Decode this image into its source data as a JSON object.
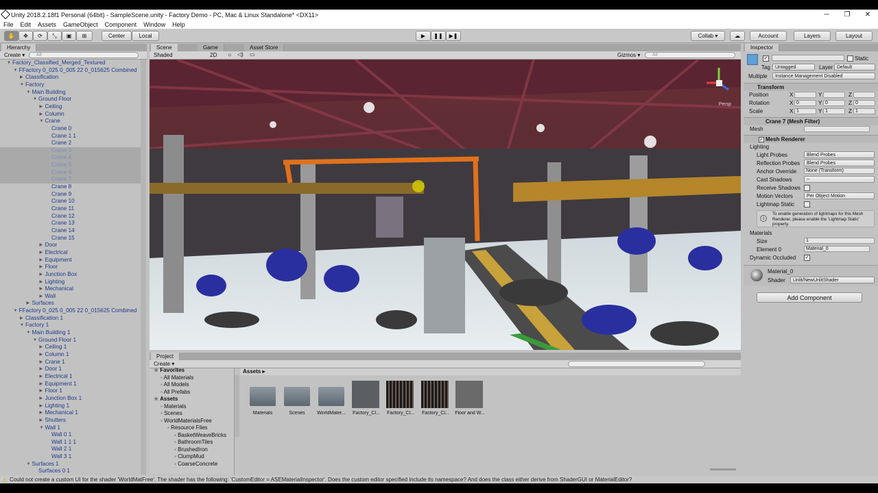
{
  "window": {
    "title": "Unity 2018.2.18f1 Personal (64bit) - SampleScene.unity - Factory Demo - PC, Mac & Linux Standalone* <DX11>"
  },
  "menu": [
    "File",
    "Edit",
    "Assets",
    "GameObject",
    "Component",
    "Window",
    "Help"
  ],
  "toolbar": {
    "pivot": "Center",
    "space": "Local",
    "collab": "Collab ▾",
    "account": "Account",
    "layers": "Layers",
    "layout": "Layout"
  },
  "hierarchy": {
    "tab": "Hierarchy",
    "create": "Create ▾",
    "search_placeholder": "All",
    "rows": [
      {
        "t": "Factory_Classified_Merged_Textured",
        "d": 0,
        "a": "open"
      },
      {
        "t": "FFactory 0_025 0_005 22 0_015625 Combined",
        "d": 1,
        "a": "open"
      },
      {
        "t": "Classification",
        "d": 2,
        "a": "closed"
      },
      {
        "t": "Factory",
        "d": 2,
        "a": "open"
      },
      {
        "t": "Main Building",
        "d": 3,
        "a": "open"
      },
      {
        "t": "Ground Floor",
        "d": 4,
        "a": "open"
      },
      {
        "t": "Ceiling",
        "d": 5,
        "a": "closed"
      },
      {
        "t": "Column",
        "d": 5,
        "a": "closed"
      },
      {
        "t": "Crane",
        "d": 5,
        "a": "open"
      },
      {
        "t": "Crane 0",
        "d": 6,
        "a": ""
      },
      {
        "t": "Crane 1 1",
        "d": 6,
        "a": ""
      },
      {
        "t": "Crane 2",
        "d": 6,
        "a": ""
      },
      {
        "t": "Crane 3",
        "d": 6,
        "a": "",
        "s": 1
      },
      {
        "t": "Crane 4",
        "d": 6,
        "a": "",
        "s": 1
      },
      {
        "t": "Crane 5",
        "d": 6,
        "a": "",
        "s": 1
      },
      {
        "t": "Crane 6",
        "d": 6,
        "a": "",
        "s": 1
      },
      {
        "t": "Crane 7",
        "d": 6,
        "a": "",
        "s": 1
      },
      {
        "t": "Crane 8",
        "d": 6,
        "a": ""
      },
      {
        "t": "Crane 9",
        "d": 6,
        "a": ""
      },
      {
        "t": "Crane 10",
        "d": 6,
        "a": ""
      },
      {
        "t": "Crane 11",
        "d": 6,
        "a": ""
      },
      {
        "t": "Crane 12",
        "d": 6,
        "a": ""
      },
      {
        "t": "Crane 13",
        "d": 6,
        "a": ""
      },
      {
        "t": "Crane 14",
        "d": 6,
        "a": ""
      },
      {
        "t": "Crane 15",
        "d": 6,
        "a": ""
      },
      {
        "t": "Door",
        "d": 5,
        "a": "closed"
      },
      {
        "t": "Electrical",
        "d": 5,
        "a": "closed"
      },
      {
        "t": "Equipment",
        "d": 5,
        "a": "closed"
      },
      {
        "t": "Floor",
        "d": 5,
        "a": "closed"
      },
      {
        "t": "Junction Box",
        "d": 5,
        "a": "closed"
      },
      {
        "t": "Lighting",
        "d": 5,
        "a": "closed"
      },
      {
        "t": "Mechanical",
        "d": 5,
        "a": "closed"
      },
      {
        "t": "Wall",
        "d": 5,
        "a": "closed"
      },
      {
        "t": "Surfaces",
        "d": 3,
        "a": "closed"
      },
      {
        "t": "FFactory 0_025 0_005 22 0_015625 Combined",
        "d": 1,
        "a": "open"
      },
      {
        "t": "Classification 1",
        "d": 2,
        "a": "closed"
      },
      {
        "t": "Factory 1",
        "d": 2,
        "a": "open"
      },
      {
        "t": "Main Building 1",
        "d": 3,
        "a": "open"
      },
      {
        "t": "Ground Floor 1",
        "d": 4,
        "a": "open"
      },
      {
        "t": "Ceiling 1",
        "d": 5,
        "a": "closed"
      },
      {
        "t": "Column 1",
        "d": 5,
        "a": "closed"
      },
      {
        "t": "Crane 1",
        "d": 5,
        "a": "closed"
      },
      {
        "t": "Door 1",
        "d": 5,
        "a": "closed"
      },
      {
        "t": "Electrical 1",
        "d": 5,
        "a": "closed"
      },
      {
        "t": "Equipment 1",
        "d": 5,
        "a": "closed"
      },
      {
        "t": "Floor 1",
        "d": 5,
        "a": "closed"
      },
      {
        "t": "Junction Box 1",
        "d": 5,
        "a": "closed"
      },
      {
        "t": "Lighting 1",
        "d": 5,
        "a": "closed"
      },
      {
        "t": "Mechanical 1",
        "d": 5,
        "a": "closed"
      },
      {
        "t": "Shutters",
        "d": 5,
        "a": "closed"
      },
      {
        "t": "Wall 1",
        "d": 5,
        "a": "open"
      },
      {
        "t": "Wall 0 1",
        "d": 6,
        "a": ""
      },
      {
        "t": "Wall 1 1 1",
        "d": 6,
        "a": ""
      },
      {
        "t": "Wall 2 1",
        "d": 6,
        "a": ""
      },
      {
        "t": "Wall 3 1",
        "d": 6,
        "a": ""
      },
      {
        "t": "Surfaces 1",
        "d": 3,
        "a": "open"
      },
      {
        "t": "Surfaces 0 1",
        "d": 4,
        "a": ""
      }
    ]
  },
  "scene": {
    "tabs": [
      "Scene",
      "Game",
      "Asset Store"
    ],
    "shading": "Shaded",
    "mode2d": "2D",
    "gizmos": "Gizmos ▾",
    "search_placeholder": "All",
    "persp": "Persp"
  },
  "inspector": {
    "tab": "Inspector",
    "static": "Static",
    "tag_label": "Tag",
    "tag": "Untagged",
    "layer_label": "Layer",
    "layer": "Default",
    "multiple": "Multiple",
    "instance_mgmt": "Instance Management Disabled",
    "transform": "Transform",
    "position": "Position",
    "rotation": "Rotation",
    "scale": "Scale",
    "px": "X",
    "py": "Y",
    "pz": "Z",
    "rot_x": "0",
    "rot_y": "0",
    "rot_z": "0",
    "scale_x": "1",
    "scale_y": "1",
    "scale_z": "1",
    "mesh_filter": "Crane 7 (Mesh Filter)",
    "mesh_label": "Mesh",
    "mesh_renderer": "Mesh Renderer",
    "lighting": "Lighting",
    "light_probes_label": "Light Probes",
    "light_probes": "Blend Probes",
    "refl_probes_label": "Reflection Probes",
    "refl_probes": "Blend Probes",
    "anchor_label": "Anchor Override",
    "anchor": "None (Transform)",
    "cast_label": "Cast Shadows",
    "cast": "--",
    "receive_label": "Receive Shadows",
    "motion_label": "Motion Vectors",
    "motion": "Per Object Motion",
    "lightmap_label": "Lightmap Static",
    "lightmap_note": "To enable generation of lightmaps for this Mesh Renderer, please enable the 'Lightmap Static' property.",
    "materials": "Materials",
    "size_label": "Size",
    "size": "1",
    "element0_label": "Element 0",
    "element0": "Material_0",
    "dynocc_label": "Dynamic Occluded",
    "material_name": "Material_0",
    "shader_label": "Shader",
    "shader": "Unlit/NewUnlitShader",
    "add_component": "Add Component"
  },
  "project": {
    "tab": "Project",
    "create": "Create ▾",
    "tree": [
      {
        "t": "Favorites",
        "d": 0,
        "b": 1
      },
      {
        "t": "All Materials",
        "d": 1
      },
      {
        "t": "All Models",
        "d": 1
      },
      {
        "t": "All Prefabs",
        "d": 1
      },
      {
        "t": "Assets",
        "d": 0,
        "b": 1
      },
      {
        "t": "Materials",
        "d": 1
      },
      {
        "t": "Scenes",
        "d": 1
      },
      {
        "t": "WorldMaterialsFree",
        "d": 1
      },
      {
        "t": "Resource Files",
        "d": 2
      },
      {
        "t": "BasketWeaveBricks",
        "d": 3
      },
      {
        "t": "BathroomTiles",
        "d": 3
      },
      {
        "t": "BrushedIron",
        "d": 3
      },
      {
        "t": "ClumpMud",
        "d": 3
      },
      {
        "t": "CoarseConcrete",
        "d": 3
      }
    ],
    "breadcrumb": "Assets ▸",
    "assets": [
      "Materials",
      "Scenes",
      "WorldMater...",
      "Factory_Cl...",
      "Factory_Cl...",
      "Factory_Cl...",
      "Floor and W..."
    ]
  },
  "status": "Could not create a custom UI for the shader 'WorldMatFree'. The shader has the following: 'CustomEditor = ASEMaterialInspector'. Does the custom editor specified include its namespace? And does the class either derive from ShaderGUI or MaterialEditor?"
}
